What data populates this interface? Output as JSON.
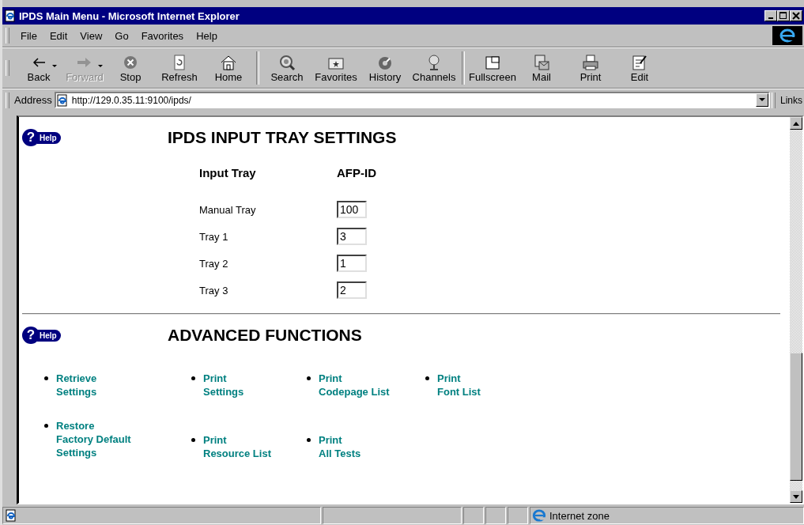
{
  "window": {
    "title": "IPDS Main Menu - Microsoft Internet Explorer"
  },
  "menu": [
    "File",
    "Edit",
    "View",
    "Go",
    "Favorites",
    "Help"
  ],
  "toolbar": [
    {
      "kind": "back",
      "label": "Back",
      "disabled": false,
      "dropdown": true
    },
    {
      "kind": "forward",
      "label": "Forward",
      "disabled": true,
      "dropdown": true
    },
    {
      "kind": "stop",
      "label": "Stop",
      "disabled": false,
      "dropdown": false
    },
    {
      "kind": "refresh",
      "label": "Refresh",
      "disabled": false,
      "dropdown": false
    },
    {
      "kind": "home",
      "label": "Home",
      "disabled": false,
      "dropdown": false
    },
    {
      "kind": "separator"
    },
    {
      "kind": "search",
      "label": "Search",
      "disabled": false,
      "dropdown": false
    },
    {
      "kind": "favorites",
      "label": "Favorites",
      "disabled": false,
      "dropdown": false
    },
    {
      "kind": "history",
      "label": "History",
      "disabled": false,
      "dropdown": false
    },
    {
      "kind": "channels",
      "label": "Channels",
      "disabled": false,
      "dropdown": false
    },
    {
      "kind": "separator"
    },
    {
      "kind": "fullscreen",
      "label": "Fullscreen",
      "disabled": false,
      "dropdown": false
    },
    {
      "kind": "mail",
      "label": "Mail",
      "disabled": false,
      "dropdown": false
    },
    {
      "kind": "print",
      "label": "Print",
      "disabled": false,
      "dropdown": false
    },
    {
      "kind": "edit",
      "label": "Edit",
      "disabled": false,
      "dropdown": false
    }
  ],
  "address_bar": {
    "label": "Address",
    "value": "http://129.0.35.11:9100/ipds/",
    "links": "Links"
  },
  "sections": [
    {
      "help_mark": "?",
      "help": "Help",
      "title": "IPDS INPUT TRAY SETTINGS",
      "table": {
        "columns": [
          "Input Tray",
          "AFP-ID"
        ],
        "rows": [
          {
            "tray": "Manual Tray",
            "value": "100"
          },
          {
            "tray": "Tray 1",
            "value": "3"
          },
          {
            "tray": "Tray 2",
            "value": "1"
          },
          {
            "tray": "Tray 3",
            "value": "2"
          }
        ]
      }
    },
    {
      "help_mark": "?",
      "help": "Help",
      "title": "ADVANCED FUNCTIONS",
      "link_columns": [
        [
          [
            "Retrieve",
            "Settings"
          ],
          [
            "Restore",
            "Factory Default",
            "Settings"
          ]
        ],
        [
          [
            "Print",
            "Settings"
          ],
          [
            "Print",
            "Resource List"
          ]
        ],
        [
          [
            "Print",
            "Codepage List"
          ],
          [
            "Print",
            "All Tests"
          ]
        ],
        [
          [
            "Print",
            "Font List"
          ]
        ]
      ]
    }
  ],
  "status_bar": {
    "zone": "Internet zone"
  }
}
